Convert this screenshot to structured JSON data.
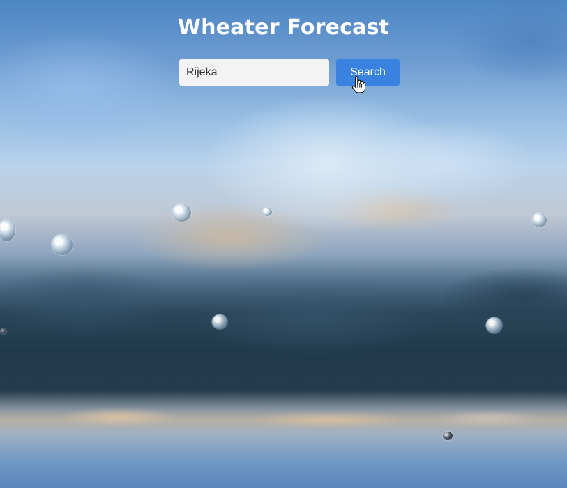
{
  "page": {
    "title": "Wheater Forecast"
  },
  "search": {
    "value": "Rijeka",
    "button_label": "Search"
  },
  "icons": {
    "cursor": "hand-pointer-icon"
  }
}
